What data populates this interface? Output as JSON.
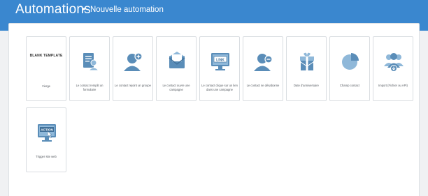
{
  "header": {
    "title": "Automations",
    "separator": "•",
    "subtitle": "Nouvelle automation"
  },
  "colors": {
    "header_bg": "#3a87cf",
    "icon_main": "#5a8db8",
    "icon_light": "#8fb8d9"
  },
  "cards": [
    {
      "title": "BLANK TEMPLATE",
      "label": "Vierge",
      "icon": "blank"
    },
    {
      "label": "Le contact remplit un formulaire",
      "icon": "form-icon"
    },
    {
      "label": "Le contact rejoint un groupe",
      "icon": "add-user-icon"
    },
    {
      "label": "Le contact ouvre une campagne",
      "icon": "open-mail-icon"
    },
    {
      "label": "Le contact clique sur un lien dans une campagne",
      "icon": "link-monitor-icon",
      "icon_text": "LINK"
    },
    {
      "label": "Le contact se désabonne",
      "icon": "remove-user-icon"
    },
    {
      "label": "Date d'anniversaire",
      "icon": "gift-icon"
    },
    {
      "label": "Champ contact",
      "icon": "pie-chart-icon"
    },
    {
      "label": "Import (Fichier ou API)",
      "icon": "import-users-icon"
    },
    {
      "label": "Trigger site web",
      "icon": "action-monitor-icon",
      "icon_text": "ACTION"
    }
  ]
}
